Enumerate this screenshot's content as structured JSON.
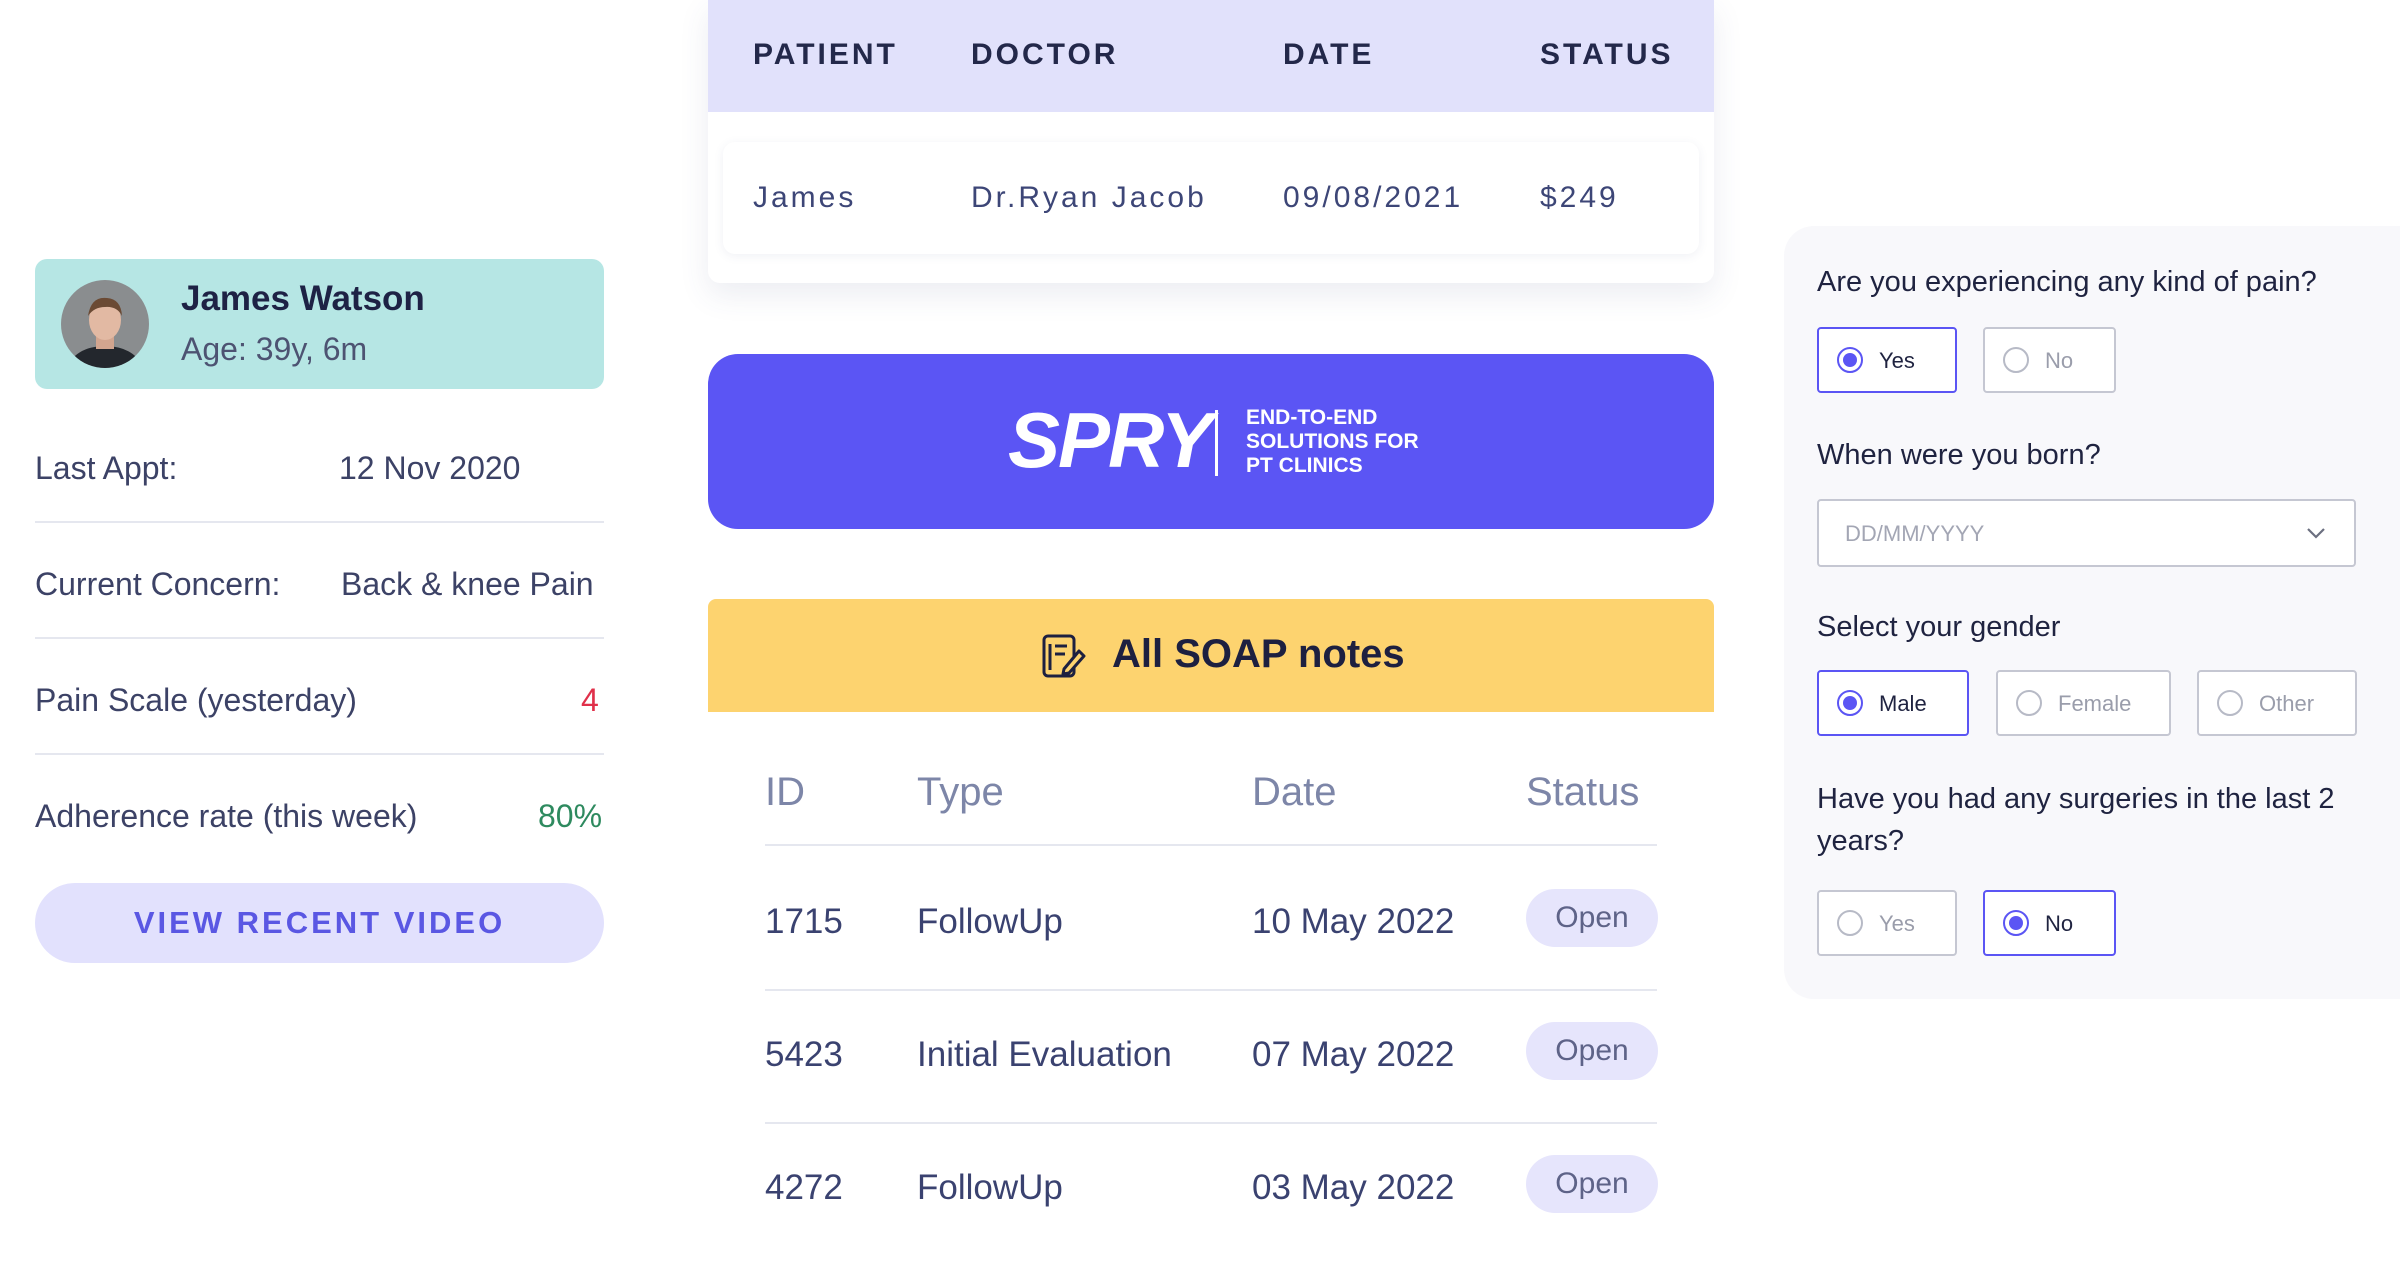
{
  "patient": {
    "name": "James Watson",
    "age": "Age: 39y, 6m",
    "rows": [
      {
        "label": "Last Appt:",
        "value": "12 Nov 2020"
      },
      {
        "label": "Current Concern:",
        "value": "Back & knee Pain"
      },
      {
        "label": "Pain Scale (yesterday)",
        "value": "4"
      },
      {
        "label": "Adherence rate (this week)",
        "value": "80%"
      }
    ],
    "button_label": "VIEW RECENT VIDEO",
    "colors": {
      "pain": "#e0304a",
      "adherence": "#2e8a5f"
    }
  },
  "appointments": {
    "columns": [
      "PATIENT",
      "DOCTOR",
      "DATE",
      "STATUS"
    ],
    "row": [
      "James",
      "Dr.Ryan Jacob",
      "09/08/2021",
      "$249"
    ]
  },
  "brand": {
    "logo": "SPRY",
    "tagline": [
      "END-TO-END",
      "SOLUTIONS FOR",
      "PT CLINICS"
    ],
    "color": "#5b55f4"
  },
  "soap": {
    "title": "All SOAP notes",
    "icon": "notes-edit-icon",
    "columns": [
      "ID",
      "Type",
      "Date",
      "Status"
    ],
    "rows": [
      {
        "id": "1715",
        "type": "FollowUp",
        "date": "10 May 2022",
        "status": "Open"
      },
      {
        "id": "5423",
        "type": "Initial Evaluation",
        "date": "07 May 2022",
        "status": "Open"
      },
      {
        "id": "4272",
        "type": "FollowUp",
        "date": "03 May 2022",
        "status": "Open"
      }
    ]
  },
  "form": {
    "q1": {
      "text": "Are you experiencing any kind of pain?",
      "options": [
        "Yes",
        "No"
      ],
      "selected": "Yes"
    },
    "q2": {
      "text": "When were you born?",
      "placeholder": "DD/MM/YYYY"
    },
    "q3": {
      "text": "Select your gender",
      "options": [
        "Male",
        "Female",
        "Other"
      ],
      "selected": "Male"
    },
    "q4": {
      "text": "Have you had any surgeries in the last 2 years?",
      "options": [
        "Yes",
        "No"
      ],
      "selected": "No"
    }
  }
}
